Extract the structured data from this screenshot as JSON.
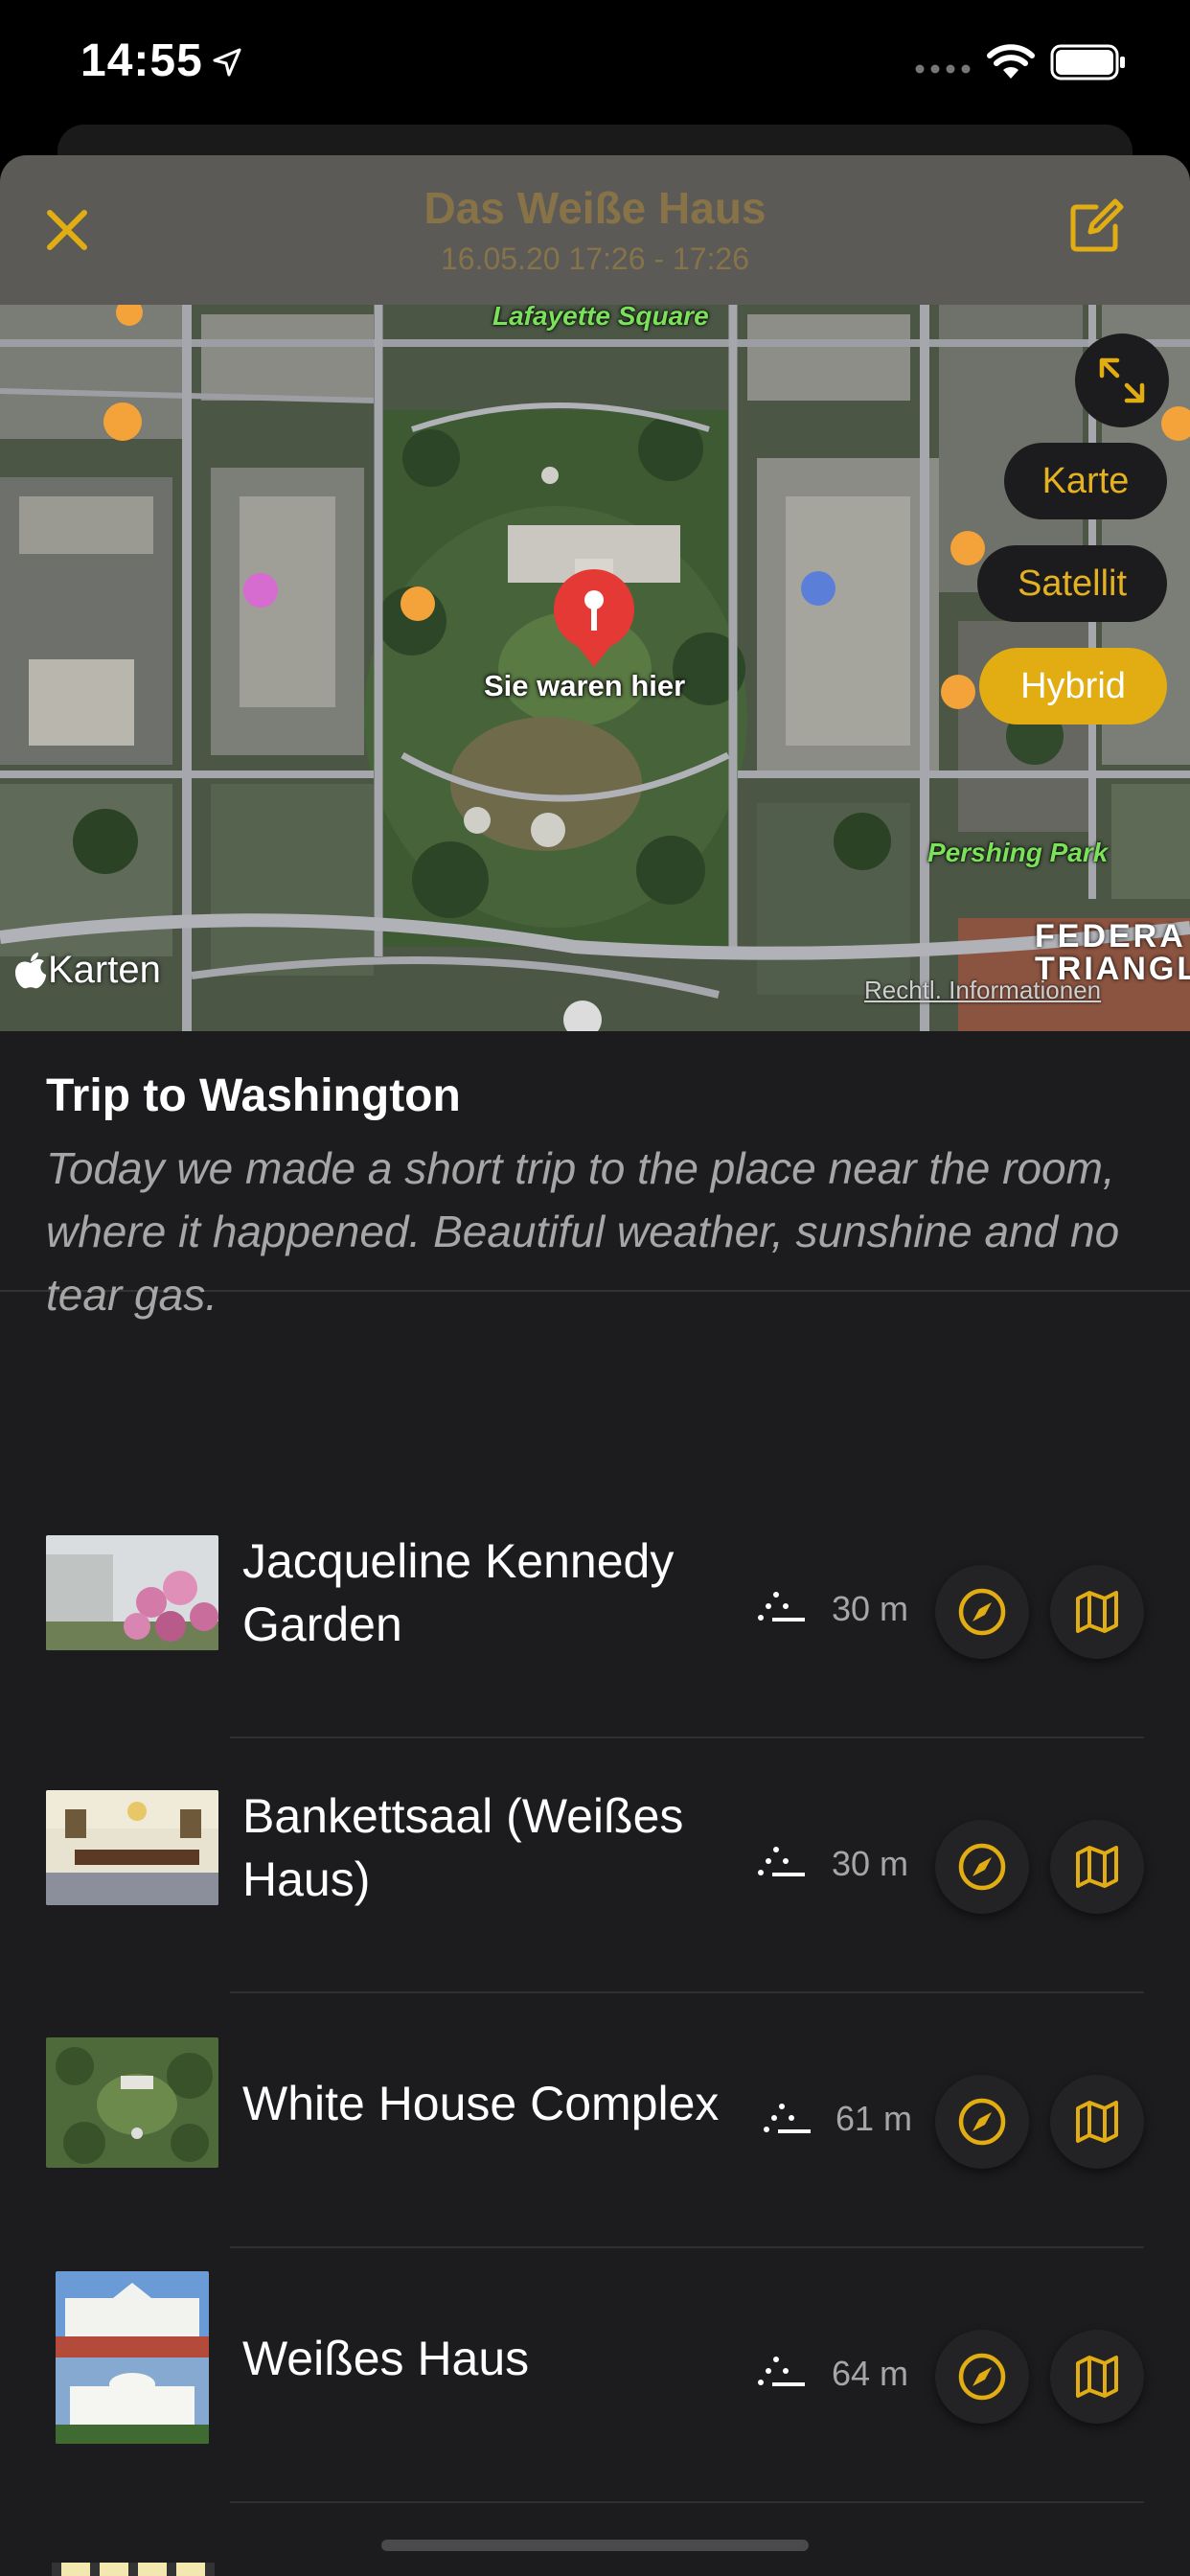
{
  "status_bar": {
    "time": "14:55"
  },
  "nav": {
    "title": "Das Weiße Haus",
    "subtitle": "16.05.20 17:26 - 17:26",
    "close_icon": "close-icon",
    "edit_icon": "edit-icon",
    "accent_color": "#e2ad12"
  },
  "map": {
    "labels": {
      "lafayette": "Lafayette Square",
      "pershing": "Pershing Park",
      "district_line1": "FEDERA",
      "district_line2": "TRIANGL",
      "pin": "Sie waren hier",
      "legal": "Rechtl. Informationen",
      "brand": "Karten"
    },
    "map_types": [
      "Karte",
      "Satellit",
      "Hybrid"
    ],
    "selected_map_type": "Hybrid"
  },
  "notes": {
    "title": "Trip to Washington",
    "text": "Today we made a short trip to the place near the room, where it happened. Beautiful weather, sunshine and no tear gas."
  },
  "places": [
    {
      "name": "Jacqueline Kennedy Garden",
      "distance": "30 m"
    },
    {
      "name": "Bankettsaal (Weißes Haus)",
      "distance": "30 m"
    },
    {
      "name": "White House Complex",
      "distance": "61 m"
    },
    {
      "name": "Weißes Haus",
      "distance": "64 m"
    }
  ]
}
